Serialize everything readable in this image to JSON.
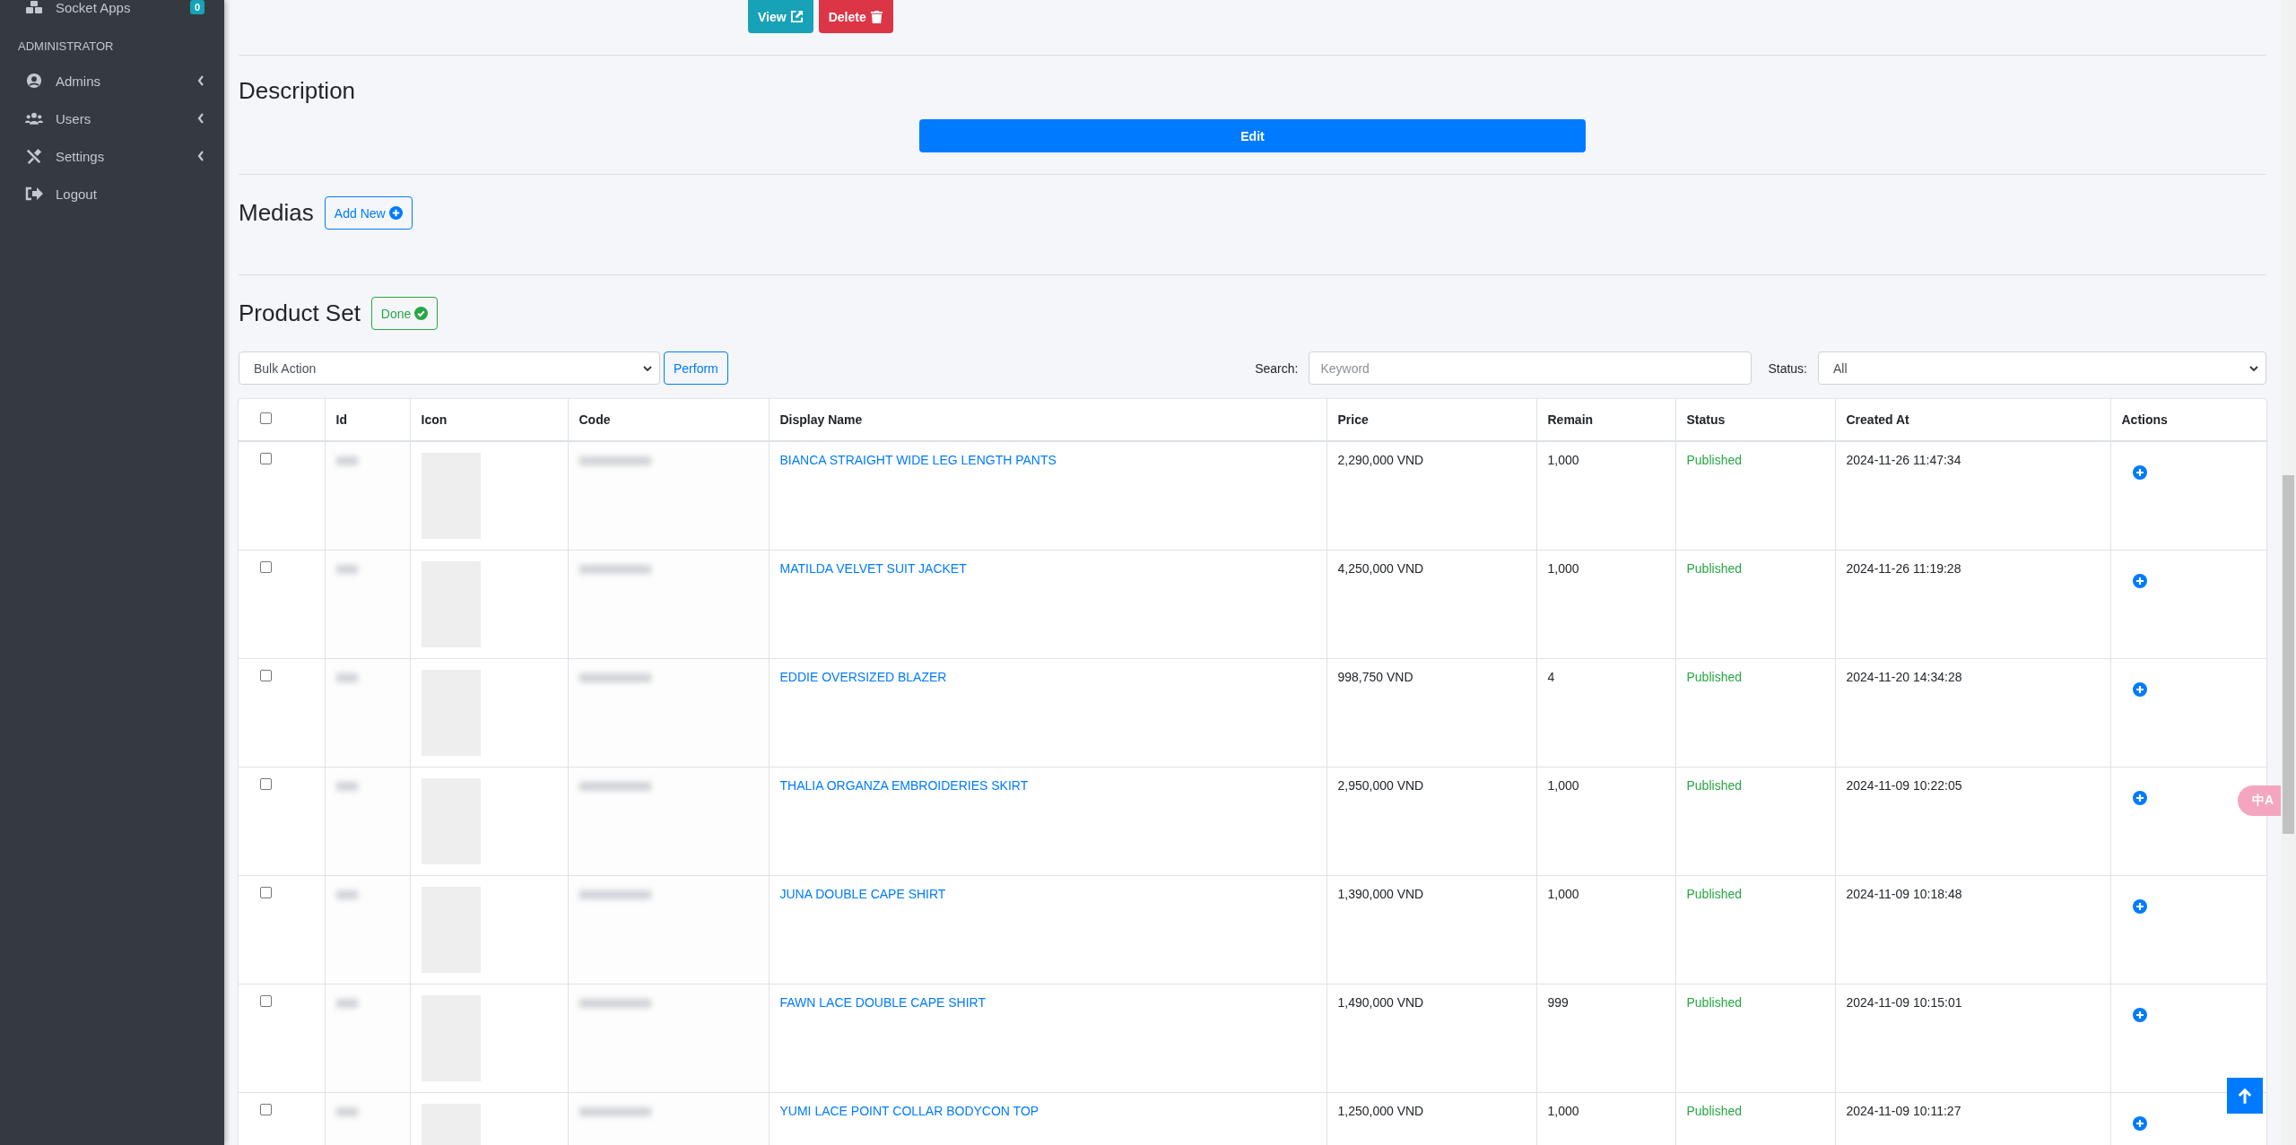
{
  "sidebar": {
    "items": [
      {
        "label": "Socket Apps",
        "badge": "0",
        "submenu": false
      },
      {
        "header": "ADMINISTRATOR"
      },
      {
        "label": "Admins",
        "submenu": true
      },
      {
        "label": "Users",
        "submenu": true
      },
      {
        "label": "Settings",
        "submenu": true
      },
      {
        "label": "Logout",
        "submenu": false
      }
    ]
  },
  "top_actions": [
    "View",
    "Delete"
  ],
  "description": {
    "title": "Description",
    "button": "Edit"
  },
  "medias": {
    "title": "Medias",
    "button": "Add New"
  },
  "product_set": {
    "title": "Product Set",
    "button": "Done",
    "bulk_action": {
      "value": "Bulk Action",
      "button": "Perform"
    },
    "search": {
      "label": "Search:",
      "placeholder": "Keyword"
    },
    "status_filter": {
      "label": "Status:",
      "value": "All"
    },
    "table": {
      "columns": [
        "Id",
        "Icon",
        "Code",
        "Display Name",
        "Price",
        "Remain",
        "Status",
        "Created At",
        "Actions"
      ],
      "select_all": {
        "checked": false
      },
      "rows": [
        {
          "checked": false,
          "name": "BIANCA STRAIGHT WIDE LEG LENGTH PANTS",
          "price": "2,290,000 VND",
          "remain": "1,000",
          "status": "Published",
          "created_at": "2024-11-26 11:47:34"
        },
        {
          "checked": false,
          "name": "MATILDA VELVET SUIT JACKET",
          "price": "4,250,000 VND",
          "remain": "1,000",
          "status": "Published",
          "created_at": "2024-11-26 11:19:28"
        },
        {
          "checked": false,
          "name": "EDDIE OVERSIZED BLAZER",
          "price": "998,750 VND",
          "remain": "4",
          "status": "Published",
          "created_at": "2024-11-20 14:34:28"
        },
        {
          "checked": false,
          "name": "THALIA ORGANZA EMBROIDERIES SKIRT",
          "price": "2,950,000 VND",
          "remain": "1,000",
          "status": "Published",
          "created_at": "2024-11-09 10:22:05"
        },
        {
          "checked": false,
          "name": "JUNA DOUBLE CAPE SHIRT",
          "price": "1,390,000 VND",
          "remain": "1,000",
          "status": "Published",
          "created_at": "2024-11-09 10:18:48"
        },
        {
          "checked": false,
          "name": "FAWN LACE DOUBLE CAPE SHIRT",
          "price": "1,490,000 VND",
          "remain": "999",
          "status": "Published",
          "created_at": "2024-11-09 10:15:01"
        },
        {
          "checked": false,
          "name": "YUMI LACE POINT COLLAR BODYCON TOP",
          "price": "1,250,000 VND",
          "remain": "1,000",
          "status": "Published",
          "created_at": "2024-11-09 10:11:27"
        }
      ]
    }
  },
  "translate_widget": {
    "label": "中A"
  }
}
